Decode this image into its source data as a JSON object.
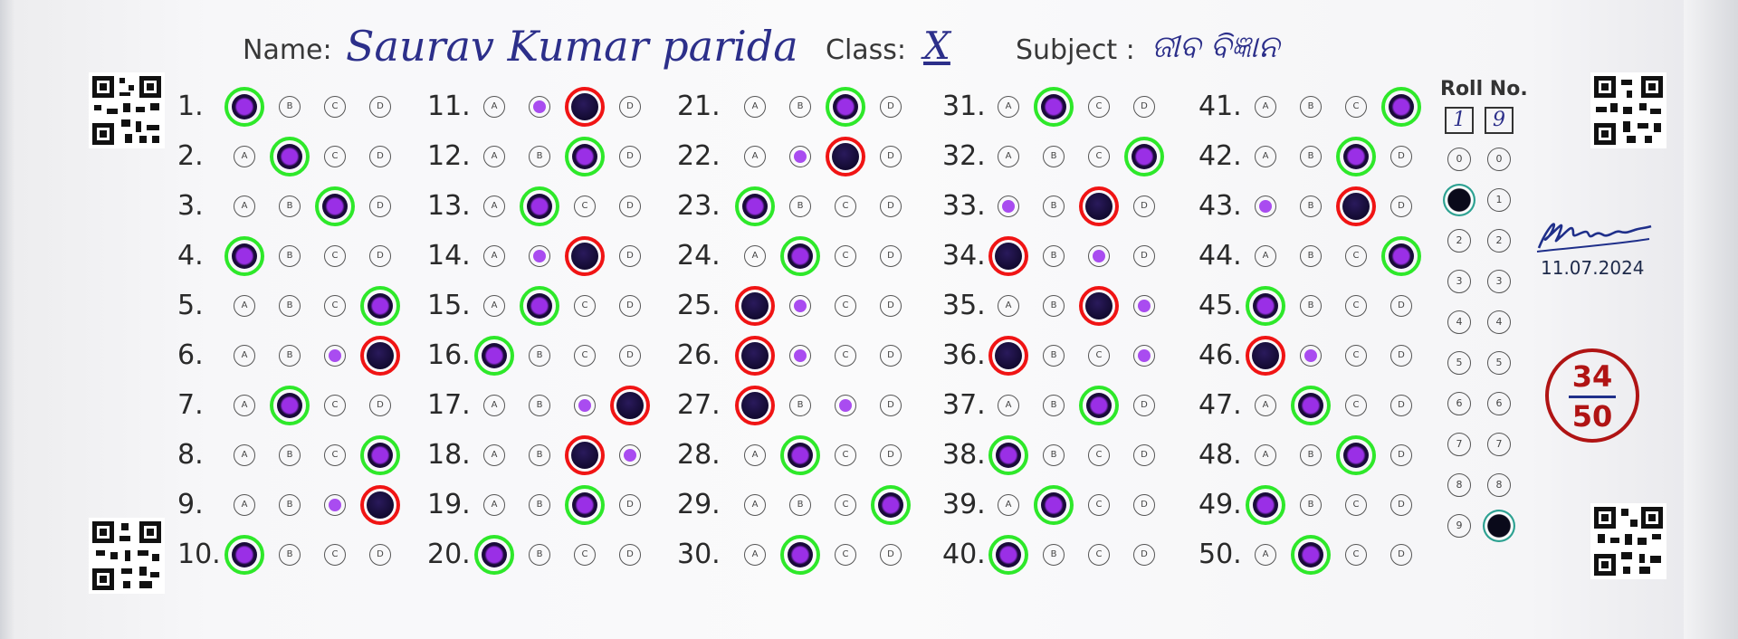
{
  "header": {
    "name_label": "Name:",
    "name_value": "Saurav Kumar parida",
    "class_label": "Class:",
    "class_value": "X",
    "subject_label": "Subject :",
    "subject_value": "ଜୀବ ବିଜ୍ଞାନ"
  },
  "answers": [
    {
      "n": "1.",
      "s": "A",
      "r": "correct",
      "d": []
    },
    {
      "n": "2.",
      "s": "B",
      "r": "correct",
      "d": []
    },
    {
      "n": "3.",
      "s": "C",
      "r": "correct",
      "d": []
    },
    {
      "n": "4.",
      "s": "A",
      "r": "correct",
      "d": []
    },
    {
      "n": "5.",
      "s": "D",
      "r": "correct",
      "d": []
    },
    {
      "n": "6.",
      "s": "D",
      "r": "wrong",
      "d": [
        "C"
      ]
    },
    {
      "n": "7.",
      "s": "B",
      "r": "correct",
      "d": []
    },
    {
      "n": "8.",
      "s": "D",
      "r": "correct",
      "d": []
    },
    {
      "n": "9.",
      "s": "D",
      "r": "wrong",
      "d": [
        "C"
      ]
    },
    {
      "n": "10.",
      "s": "A",
      "r": "correct",
      "d": []
    },
    {
      "n": "11.",
      "s": "C",
      "r": "wrong",
      "d": [
        "B"
      ]
    },
    {
      "n": "12.",
      "s": "C",
      "r": "correct",
      "d": []
    },
    {
      "n": "13.",
      "s": "B",
      "r": "correct",
      "d": []
    },
    {
      "n": "14.",
      "s": "C",
      "r": "wrong",
      "d": [
        "B"
      ]
    },
    {
      "n": "15.",
      "s": "B",
      "r": "correct",
      "d": []
    },
    {
      "n": "16.",
      "s": "A",
      "r": "correct",
      "d": []
    },
    {
      "n": "17.",
      "s": "D",
      "r": "wrong",
      "d": [
        "C"
      ]
    },
    {
      "n": "18.",
      "s": "C",
      "r": "wrong",
      "d": [
        "D"
      ]
    },
    {
      "n": "19.",
      "s": "C",
      "r": "correct",
      "d": []
    },
    {
      "n": "20.",
      "s": "A",
      "r": "correct",
      "d": []
    },
    {
      "n": "21.",
      "s": "C",
      "r": "correct",
      "d": []
    },
    {
      "n": "22.",
      "s": "C",
      "r": "wrong",
      "d": [
        "B"
      ]
    },
    {
      "n": "23.",
      "s": "A",
      "r": "correct",
      "d": []
    },
    {
      "n": "24.",
      "s": "B",
      "r": "correct",
      "d": []
    },
    {
      "n": "25.",
      "s": "A",
      "r": "wrong",
      "d": [
        "B"
      ]
    },
    {
      "n": "26.",
      "s": "A",
      "r": "wrong",
      "d": [
        "B"
      ]
    },
    {
      "n": "27.",
      "s": "A",
      "r": "wrong",
      "d": [
        "C"
      ]
    },
    {
      "n": "28.",
      "s": "B",
      "r": "correct",
      "d": []
    },
    {
      "n": "29.",
      "s": "D",
      "r": "correct",
      "d": []
    },
    {
      "n": "30.",
      "s": "B",
      "r": "correct",
      "d": []
    },
    {
      "n": "31.",
      "s": "B",
      "r": "correct",
      "d": []
    },
    {
      "n": "32.",
      "s": "D",
      "r": "correct",
      "d": []
    },
    {
      "n": "33.",
      "s": "C",
      "r": "wrong",
      "d": [
        "A"
      ]
    },
    {
      "n": "34.",
      "s": "A",
      "r": "wrong",
      "d": [
        "C"
      ]
    },
    {
      "n": "35.",
      "s": "C",
      "r": "wrong",
      "d": [
        "D"
      ]
    },
    {
      "n": "36.",
      "s": "A",
      "r": "wrong",
      "d": [
        "D"
      ]
    },
    {
      "n": "37.",
      "s": "C",
      "r": "correct",
      "d": []
    },
    {
      "n": "38.",
      "s": "A",
      "r": "correct",
      "d": []
    },
    {
      "n": "39.",
      "s": "B",
      "r": "correct",
      "d": []
    },
    {
      "n": "40.",
      "s": "A",
      "r": "correct",
      "d": []
    },
    {
      "n": "41.",
      "s": "D",
      "r": "correct",
      "d": []
    },
    {
      "n": "42.",
      "s": "C",
      "r": "correct",
      "d": []
    },
    {
      "n": "43.",
      "s": "C",
      "r": "wrong",
      "d": [
        "A"
      ]
    },
    {
      "n": "44.",
      "s": "D",
      "r": "correct",
      "d": []
    },
    {
      "n": "45.",
      "s": "A",
      "r": "correct",
      "d": []
    },
    {
      "n": "46.",
      "s": "A",
      "r": "wrong",
      "d": [
        "B"
      ]
    },
    {
      "n": "47.",
      "s": "B",
      "r": "correct",
      "d": []
    },
    {
      "n": "48.",
      "s": "C",
      "r": "correct",
      "d": []
    },
    {
      "n": "49.",
      "s": "A",
      "r": "correct",
      "d": []
    },
    {
      "n": "50.",
      "s": "B",
      "r": "correct",
      "d": []
    }
  ],
  "roll": {
    "label": "Roll No.",
    "digit1": "1",
    "digit2": "9",
    "digits": [
      "0",
      "1",
      "2",
      "3",
      "4",
      "5",
      "6",
      "7",
      "8",
      "9"
    ]
  },
  "signature": {
    "text": "SSSahu",
    "date": "11.07.2024"
  },
  "score": {
    "obtained": "34",
    "total": "50"
  },
  "colors": {
    "correct_ring": "#2ee82a",
    "wrong_ring": "#f01414",
    "fill": "#9a2fe6",
    "handwriting": "#2c2f8a",
    "score": "#b01414"
  }
}
